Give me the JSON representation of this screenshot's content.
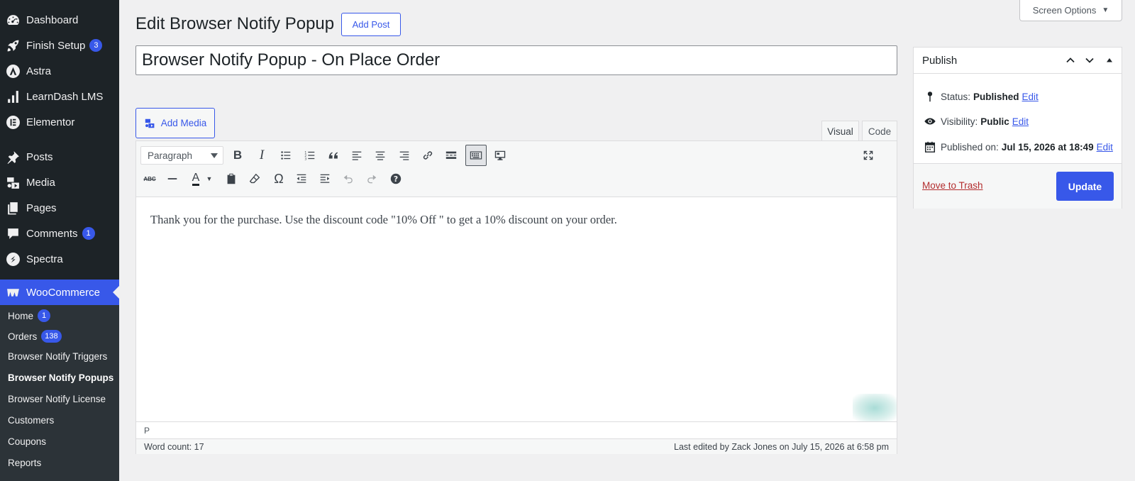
{
  "sidebar": {
    "items": [
      {
        "label": "Dashboard",
        "icon": "dashboard-icon"
      },
      {
        "label": "Finish Setup",
        "icon": "rocket-icon",
        "badge": "3"
      },
      {
        "label": "Astra",
        "icon": "astra-icon"
      },
      {
        "label": "LearnDash LMS",
        "icon": "chart-bars-icon"
      },
      {
        "label": "Elementor",
        "icon": "elementor-icon"
      },
      {
        "label": "Posts",
        "icon": "pushpin-icon"
      },
      {
        "label": "Media",
        "icon": "media-icon"
      },
      {
        "label": "Pages",
        "icon": "pages-icon"
      },
      {
        "label": "Comments",
        "icon": "comment-icon",
        "badge": "1"
      },
      {
        "label": "Spectra",
        "icon": "spectra-icon"
      },
      {
        "label": "WooCommerce",
        "icon": "woocommerce-icon"
      }
    ],
    "submenu": [
      {
        "label": "Home",
        "badge": "1"
      },
      {
        "label": "Orders",
        "badge": "138"
      },
      {
        "label": "Browser Notify Triggers"
      },
      {
        "label": "Browser Notify Popups"
      },
      {
        "label": "Browser Notify License"
      },
      {
        "label": "Customers"
      },
      {
        "label": "Coupons"
      },
      {
        "label": "Reports"
      }
    ]
  },
  "header": {
    "title": "Edit Browser Notify Popup",
    "add_post": "Add Post",
    "screen_options": "Screen Options"
  },
  "post": {
    "title": "Browser Notify Popup - On Place Order",
    "content": "Thank you for the purchase. Use the discount code \"10% Off \" to get a 10% discount on your order."
  },
  "editor": {
    "add_media": "Add Media",
    "tab_visual": "Visual",
    "tab_code": "Code",
    "format": "Paragraph",
    "path": "P",
    "word_count": "Word count: 17",
    "last_edited": "Last edited by Zack Jones on July 15, 2026 at 6:58 pm"
  },
  "publish": {
    "title": "Publish",
    "status_label": "Status:",
    "status_value": "Published",
    "visibility_label": "Visibility:",
    "visibility_value": "Public",
    "published_label": "Published on:",
    "published_value": "Jul 15, 2026 at 18:49",
    "edit": "Edit",
    "trash": "Move to Trash",
    "update": "Update"
  },
  "colors": {
    "accent": "#3858e9",
    "sidebar_bg": "#1d2327",
    "trash": "#b32d2e"
  }
}
